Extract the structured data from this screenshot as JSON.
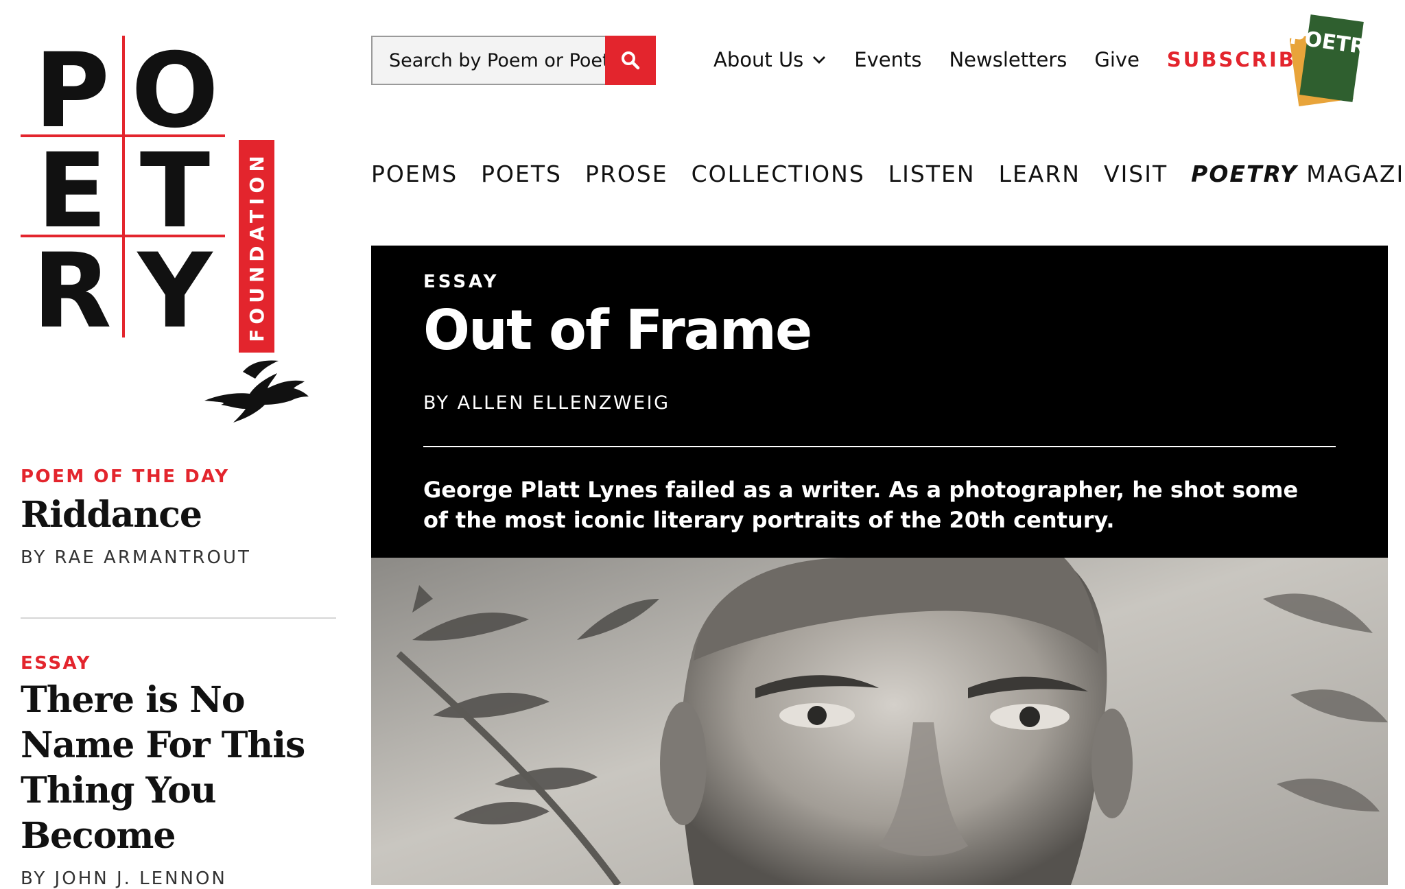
{
  "logo": {
    "letters": [
      "P",
      "O",
      "E",
      "T",
      "R",
      "Y"
    ],
    "foundation": "FOUNDATION",
    "brand_red": "#e3252d"
  },
  "search": {
    "placeholder": "Search by Poem or Poet",
    "icon": "search-icon"
  },
  "utility_nav": {
    "about": "About Us",
    "events": "Events",
    "newsletters": "Newsletters",
    "give": "Give",
    "subscribe": "SUBSCRIBE"
  },
  "magazine_thumb": {
    "letters": "POETRY"
  },
  "main_nav": {
    "poems": "POEMS",
    "poets": "POETS",
    "prose": "PROSE",
    "collections": "COLLECTIONS",
    "listen": "LISTEN",
    "learn": "LEARN",
    "visit": "VISIT",
    "poetry_magazine_em": "POETRY",
    "poetry_magazine_rest": "MAGAZINE"
  },
  "sidebar": {
    "poem_of_day": {
      "kicker": "POEM OF THE DAY",
      "title": "Riddance",
      "byline": "BY RAE ARMANTROUT"
    },
    "essay": {
      "kicker": "ESSAY",
      "title": "There is No Name For This Thing You Become",
      "byline": "BY JOHN J. LENNON"
    }
  },
  "hero": {
    "kicker": "ESSAY",
    "title": "Out of Frame",
    "byline": "BY ALLEN ELLENZWEIG",
    "dek": "George Platt Lynes failed as a writer. As a photographer, he shot some of the most iconic literary portraits of the 20th century."
  }
}
